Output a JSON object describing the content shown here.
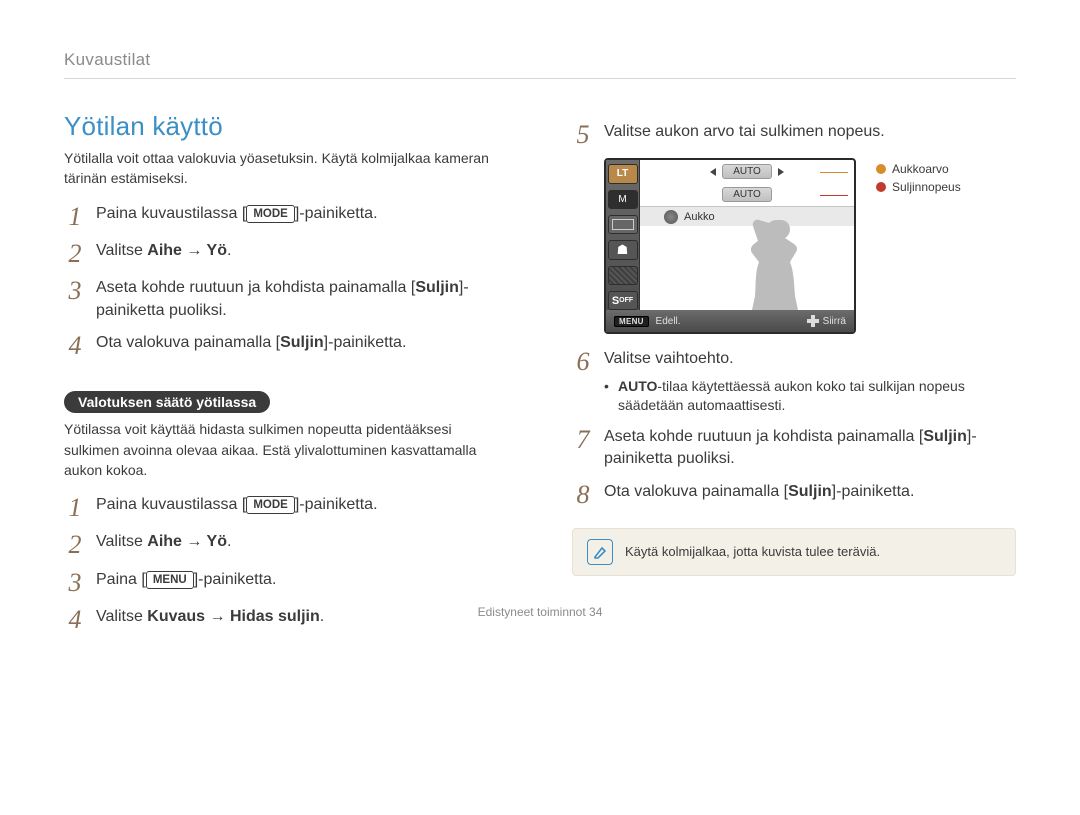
{
  "header": {
    "section": "Kuvaustilat"
  },
  "left": {
    "title": "Yötilan käyttö",
    "intro": "Yötilalla voit ottaa valokuvia yöasetuksin. Käytä kolmijalkaa kameran tärinän estämiseksi.",
    "steps1": [
      {
        "num": "1",
        "pre": "Paina kuvaustilassa [",
        "key": "MODE",
        "post": "]-painiketta."
      },
      {
        "num": "2",
        "plain_pre": "Valitse ",
        "bold": "Aihe → Yö",
        "plain_post": "."
      },
      {
        "num": "3",
        "pre": "Aseta kohde ruutuun ja kohdista painamalla [",
        "bold": "Suljin",
        "post": "]-painiketta puoliksi."
      },
      {
        "num": "4",
        "pre": "Ota valokuva painamalla [",
        "bold": "Suljin",
        "post": "]-painiketta."
      }
    ],
    "pill": "Valotuksen säätö yötilassa",
    "sub_intro": "Yötilassa voit käyttää hidasta sulkimen nopeutta pidentääksesi sulkimen avoinna olevaa aikaa. Estä ylivalottuminen kasvattamalla aukon kokoa.",
    "steps2": [
      {
        "num": "1",
        "pre": "Paina kuvaustilassa [",
        "key": "MODE",
        "post": "]-painiketta."
      },
      {
        "num": "2",
        "plain_pre": "Valitse ",
        "bold": "Aihe → Yö",
        "plain_post": "."
      },
      {
        "num": "3",
        "pre": "Paina [",
        "key": "MENU",
        "post": "]-painiketta."
      },
      {
        "num": "4",
        "plain_pre": "Valitse ",
        "bold": "Kuvaus → Hidas suljin",
        "plain_post": "."
      }
    ]
  },
  "right": {
    "steps": [
      {
        "num": "5",
        "plain": "Valitse aukon arvo tai sulkimen nopeus."
      },
      {
        "num": "6",
        "plain": "Valitse vaihtoehto.",
        "bullet_bold": "AUTO",
        "bullet_rest": "-tilaa käytettäessä aukon koko tai sulkijan nopeus säädetään automaattisesti."
      },
      {
        "num": "7",
        "pre": "Aseta kohde ruutuun ja kohdista painamalla [",
        "bold": "Suljin",
        "post": "]-painiketta puoliksi."
      },
      {
        "num": "8",
        "pre": "Ota valokuva painamalla [",
        "bold": "Suljin",
        "post": "]-painiketta."
      }
    ],
    "note": "Käytä kolmijalkaa, jotta kuvista tulee teräviä."
  },
  "lcd": {
    "active_mode": "LT",
    "m_label": "M",
    "s_label": "S",
    "chip1": "AUTO",
    "chip2": "AUTO",
    "row_label": "Aukko",
    "footer_menu": "MENU",
    "footer_back": "Edell.",
    "footer_move": "Siirrä",
    "callouts": {
      "aperture": "Aukkoarvo",
      "shutter": "Suljinnopeus"
    }
  },
  "footer": {
    "label": "Edistyneet toiminnot",
    "page": "34"
  }
}
